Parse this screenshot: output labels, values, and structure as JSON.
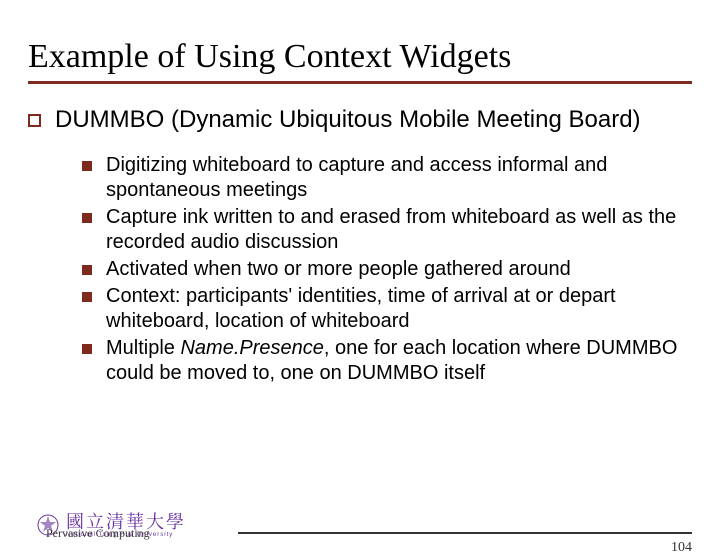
{
  "title": "Example of Using Context Widgets",
  "main": {
    "heading": "DUMMBO (Dynamic Ubiquitous Mobile Meeting Board)",
    "bullets": [
      "Digitizing whiteboard to capture and access informal and spontaneous meetings",
      "Capture ink written to and erased from whiteboard as well as the recorded audio discussion",
      "Activated when two or more people gathered around",
      "Context: participants' identities, time of arrival at or depart whiteboard, location of whiteboard"
    ],
    "bullet5_pre": "Multiple ",
    "bullet5_em": "Name.Presence",
    "bullet5_post": ", one for each location where DUMMBO could be moved to, one on DUMMBO itself"
  },
  "footer": {
    "course": "Pervasive Computing",
    "page": "104",
    "uni_cn": "國立清華大學",
    "uni_en": "National Tsing Hua University"
  }
}
